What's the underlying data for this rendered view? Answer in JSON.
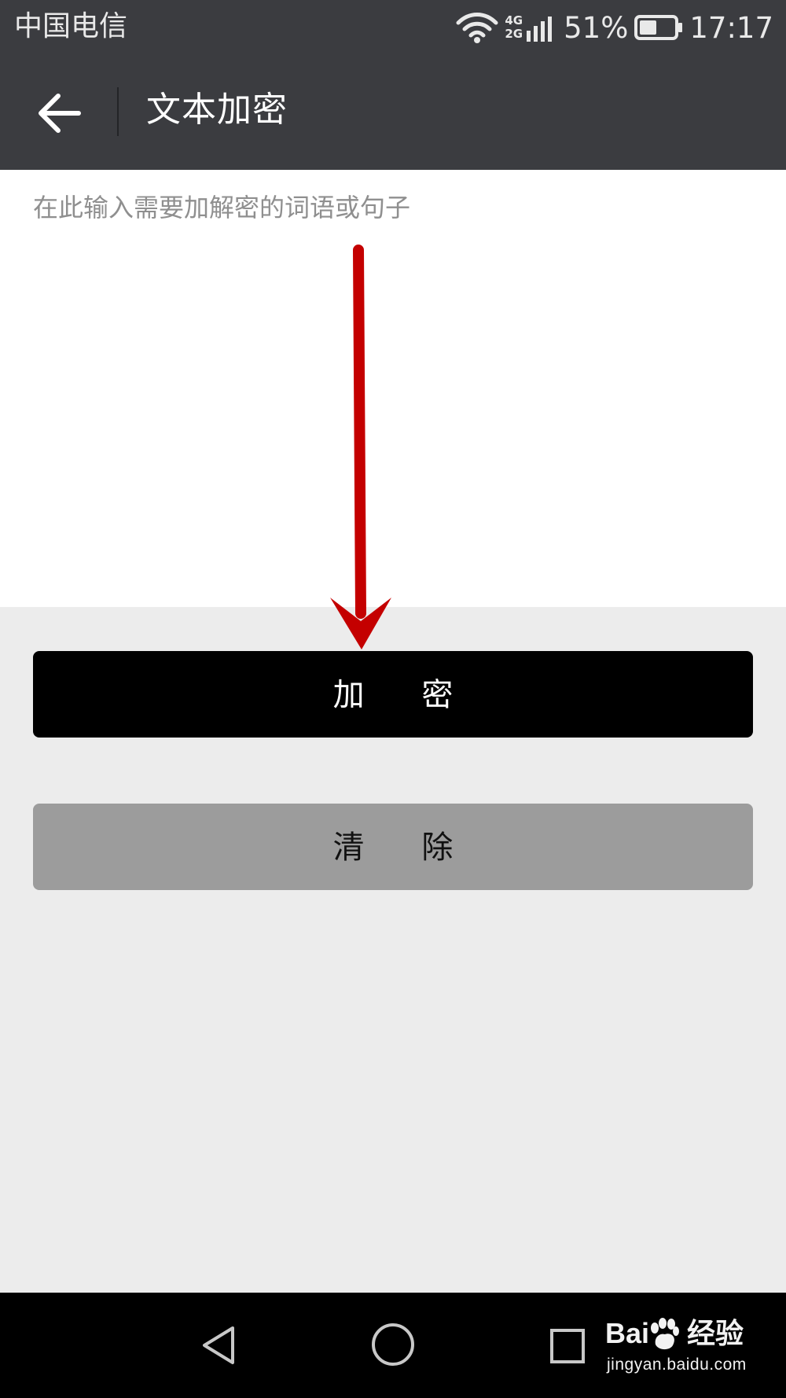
{
  "status_bar": {
    "carrier": "中国电信",
    "network_top": "4G",
    "network_bottom": "2G",
    "battery_percent_text": "51%",
    "battery_level": 0.51,
    "time": "17:17"
  },
  "app_bar": {
    "title": "文本加密",
    "back_icon": "arrow-left-icon"
  },
  "editor": {
    "placeholder": "在此输入需要加解密的词语或句子",
    "value": ""
  },
  "buttons": {
    "encrypt_label": "加 密",
    "clear_label": "清 除"
  },
  "annotation": {
    "arrow_color": "#c40000"
  },
  "nav_bar": {
    "back_icon": "triangle-back-icon",
    "home_icon": "circle-home-icon",
    "recent_icon": "square-recent-icon"
  },
  "watermark": {
    "logo_text": "Bai",
    "logo_suffix": "经验",
    "domain": "jingyan.baidu.com"
  },
  "colors": {
    "app_bar": "#3b3c40",
    "content_bg": "#ececec",
    "encrypt_button": "#000000",
    "clear_button": "#9c9c9c"
  }
}
